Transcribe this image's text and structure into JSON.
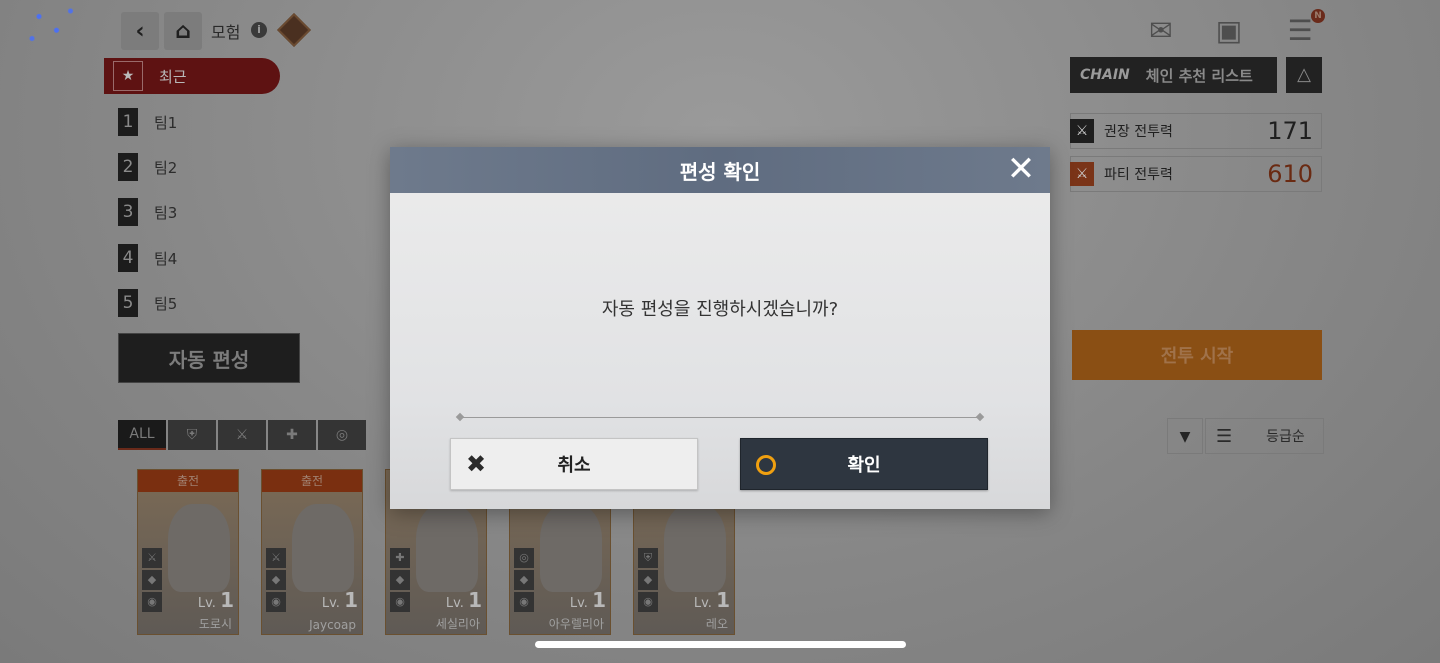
{
  "header": {
    "back_icon": "chevron-left-icon",
    "home_icon": "home-icon",
    "title": "모험",
    "mail_icon": "mail-icon",
    "inventory_icon": "backpack-icon",
    "menu_icon": "hamburger-menu-icon",
    "menu_badge": "N"
  },
  "left_panel": {
    "recent_label": "최근",
    "teams": [
      {
        "num": "1",
        "label": "팀1"
      },
      {
        "num": "2",
        "label": "팀2"
      },
      {
        "num": "3",
        "label": "팀3"
      },
      {
        "num": "4",
        "label": "팀4"
      },
      {
        "num": "5",
        "label": "팀5"
      }
    ],
    "auto_button": "자동 편성",
    "filters": [
      "ALL",
      "",
      "",
      "",
      ""
    ]
  },
  "characters": [
    {
      "deploy": "출전",
      "lv_label": "Lv.",
      "lv": "1",
      "name": "도로시"
    },
    {
      "deploy": "출전",
      "lv_label": "Lv.",
      "lv": "1",
      "name": "Jaycoap"
    },
    {
      "deploy": "",
      "lv_label": "Lv.",
      "lv": "1",
      "name": "세실리아"
    },
    {
      "deploy": "",
      "lv_label": "Lv.",
      "lv": "1",
      "name": "아우렐리아"
    },
    {
      "deploy": "",
      "lv_label": "Lv.",
      "lv": "1",
      "name": "레오"
    }
  ],
  "right_panel": {
    "chain_logo": "CHAIN",
    "chain_label": "체인 추천 리스트",
    "recommended_power_label": "권장 전투력",
    "recommended_power_value": "171",
    "party_power_label": "파티 전투력",
    "party_power_value": "610",
    "battle_start": "전투 시작",
    "sort_label": "등급순"
  },
  "modal": {
    "title": "편성 확인",
    "message": "자동 편성을 진행하시겠습니까?",
    "cancel_label": "취소",
    "confirm_label": "확인"
  },
  "colors": {
    "accent_orange": "#f0a010",
    "modal_header": "#5f6c80",
    "confirm_bg": "#2e3640",
    "party_power": "#c0502a"
  }
}
